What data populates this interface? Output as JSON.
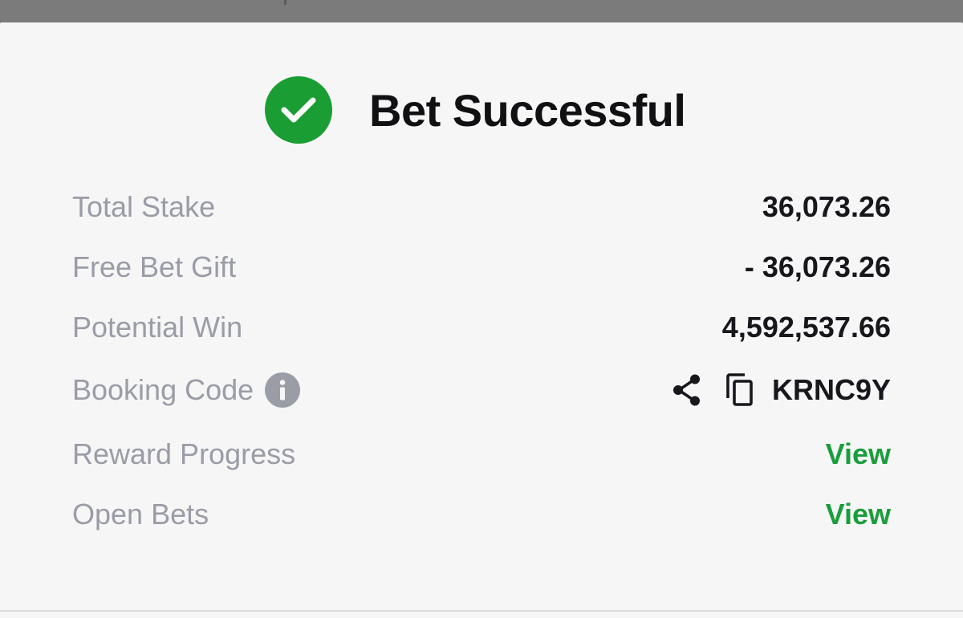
{
  "colors": {
    "success_green": "#1a9e33",
    "link_green": "#1a9e3c",
    "label_gray": "#9a9ca6",
    "value_dark": "#17171c"
  },
  "header": {
    "title": "Bet Successful",
    "status_icon": "check-circle-icon"
  },
  "details": {
    "total_stake": {
      "label": "Total Stake",
      "value": "36,073.26"
    },
    "free_bet_gift": {
      "label": "Free Bet Gift",
      "value": "- 36,073.26"
    },
    "potential_win": {
      "label": "Potential Win",
      "value": "4,592,537.66"
    },
    "booking_code": {
      "label": "Booking Code",
      "value": "KRNC9Y",
      "info_icon": "info-icon",
      "share_icon": "share-icon",
      "copy_icon": "copy-icon"
    },
    "reward_progress": {
      "label": "Reward Progress",
      "link": "View"
    },
    "open_bets": {
      "label": "Open Bets",
      "link": "View"
    }
  }
}
